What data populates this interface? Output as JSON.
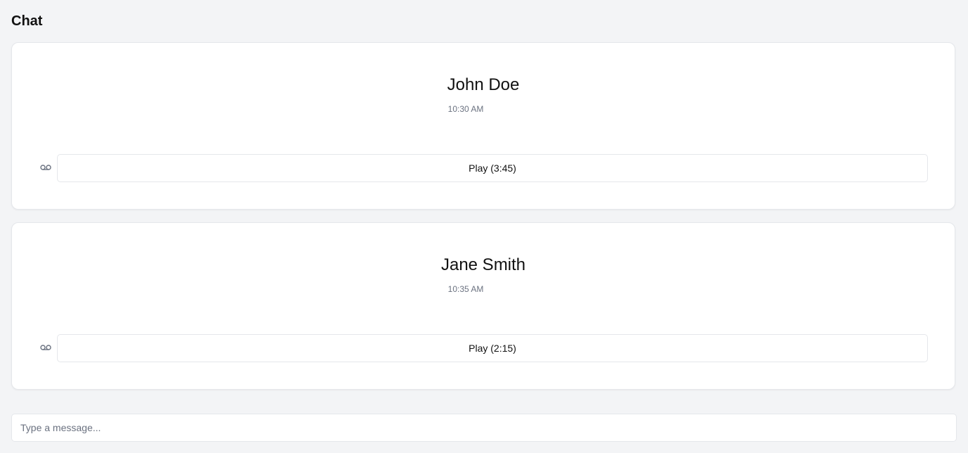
{
  "header": {
    "title": "Chat"
  },
  "messages": [
    {
      "sender": "John Doe",
      "time": "10:30 AM",
      "icon": "voicemail-icon",
      "play_label": "Play (3:45)"
    },
    {
      "sender": "Jane Smith",
      "time": "10:35 AM",
      "icon": "voicemail-icon",
      "play_label": "Play (2:15)"
    }
  ],
  "composer": {
    "value": "",
    "placeholder": "Type a message..."
  },
  "colors": {
    "background": "#f3f4f6",
    "card": "#ffffff",
    "border": "#e5e7eb",
    "text": "#111111",
    "muted_text": "#6b7280"
  }
}
